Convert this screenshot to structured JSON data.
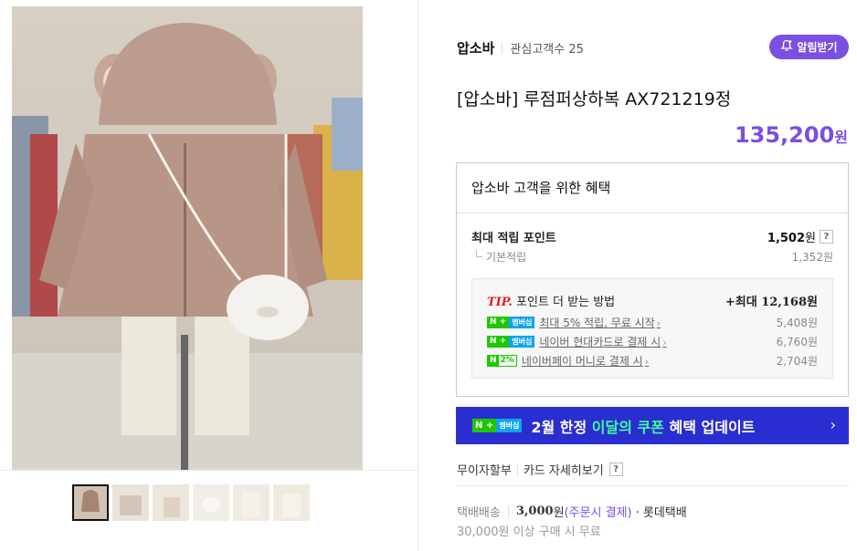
{
  "store": {
    "name": "압소바",
    "fans": "관심고객수 25",
    "alarm_label": "알림받기"
  },
  "product": {
    "title": "[압소바] 루점퍼상하복 AX721219정",
    "price": "135,200",
    "currency": "원"
  },
  "benefits": {
    "header": "압소바 고객을 위한 혜택",
    "max_point_label": "최대 적립 포인트",
    "max_point_value": "1,502",
    "max_point_unit": "원",
    "base_label": "기본적립",
    "base_value": "1,352원",
    "tip": {
      "tip_word": "TIP.",
      "title": "포인트 더 받는 방법",
      "max_label": "+최대",
      "max_value": "12,168",
      "max_unit": "원",
      "rows": [
        {
          "badge": "멤버십",
          "text": "최대 5% 적립, 무료 시작",
          "value": "5,408원"
        },
        {
          "badge": "멤버십",
          "text": "네이버 현대카드로 결제 시",
          "value": "6,760원"
        },
        {
          "badge": "2%",
          "text": "네이버페이 머니로 결제 시",
          "value": "2,704원"
        }
      ]
    }
  },
  "banner": {
    "badge": "멤버십",
    "text_a": "2월 한정 ",
    "text_hl": "이달의 쿠폰",
    "text_b": " 혜택 업데이트"
  },
  "payment": {
    "installment": "무이자할부",
    "card_detail": "카드 자세히보기"
  },
  "shipping": {
    "label": "택배배송",
    "fee": "3,000",
    "fee_unit": "원",
    "condition": "(주문시 결제)",
    "carrier": "· 롯데택배",
    "free_text": "30,000원 이상 구매 시 무료"
  },
  "colors": {
    "accent": "#7b4fe0",
    "banner_bg": "#2a2ed0",
    "naver_green": "#1ec800"
  }
}
